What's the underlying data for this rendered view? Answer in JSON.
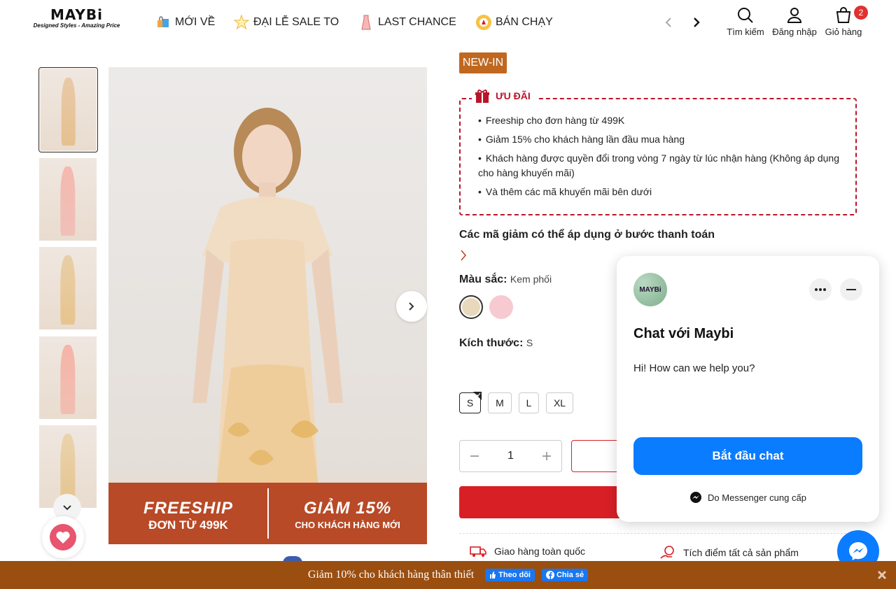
{
  "header": {
    "logo_main": "MAYBi",
    "logo_sub": "Designed Styles - Amazing Price",
    "nav": [
      {
        "label": "MỚI VỀ",
        "icon": "shopping-bags-icon"
      },
      {
        "label": "ĐẠI LỄ SALE TO",
        "icon": "sale-star-icon"
      },
      {
        "label": "LAST CHANCE",
        "icon": "dress-icon"
      },
      {
        "label": "BÁN CHẠY",
        "icon": "bestseller-badge-icon"
      }
    ],
    "search_label": "Tìm kiếm",
    "login_label": "Đăng nhập",
    "cart_label": "Giỏ hàng",
    "cart_count": "2"
  },
  "gallery": {
    "promo_left_big": "FREESHIP",
    "promo_left_small": "ĐƠN TỪ 499K",
    "promo_right_big": "GIẢM 15%",
    "promo_right_small": "CHO KHÁCH HÀNG MỚI"
  },
  "product": {
    "badge": "NEW-IN",
    "offer_title": "ƯU ĐÃI",
    "offers": [
      "Freeship cho đơn hàng từ 499K",
      "Giảm 15% cho khách hàng lần đầu mua hàng",
      "Khách hàng được quyền đổi trong vòng 7 ngày từ lúc nhận hàng (Không áp dụng cho hàng khuyến mãi)",
      "Và thêm các mã khuyến mãi bên dưới"
    ],
    "coupon_title": "Các mã giảm có thể áp dụng ở bước thanh toán",
    "color_label": "Màu sắc:",
    "color_value": "Kem phối",
    "swatches": [
      "#e8d9bd",
      "#f7c9d1"
    ],
    "size_label": "Kích thước:",
    "size_value": "S",
    "sizes": [
      "S",
      "M",
      "L",
      "XL"
    ],
    "quantity": "1",
    "perk_shipping": "Giao hàng toàn quốc",
    "perk_points": "Tích điểm tất cả sản phẩm"
  },
  "chat": {
    "avatar_text": "MAYBi",
    "title": "Chat với Maybi",
    "message": "Hi! How can we help you?",
    "start_button": "Bắt đầu chat",
    "powered_by": "Do Messenger cung cấp"
  },
  "bottom_bar": {
    "text": "Giảm 10% cho khách hàng thân thiết",
    "follow": "Theo dõi",
    "share": "Chia sẻ"
  },
  "colors": {
    "accent_red": "#d81f26",
    "offer_red": "#b8162b",
    "badge_orange": "#c0681f",
    "bottom_bar": "#9a4e10",
    "messenger_blue": "#0a7cff"
  }
}
